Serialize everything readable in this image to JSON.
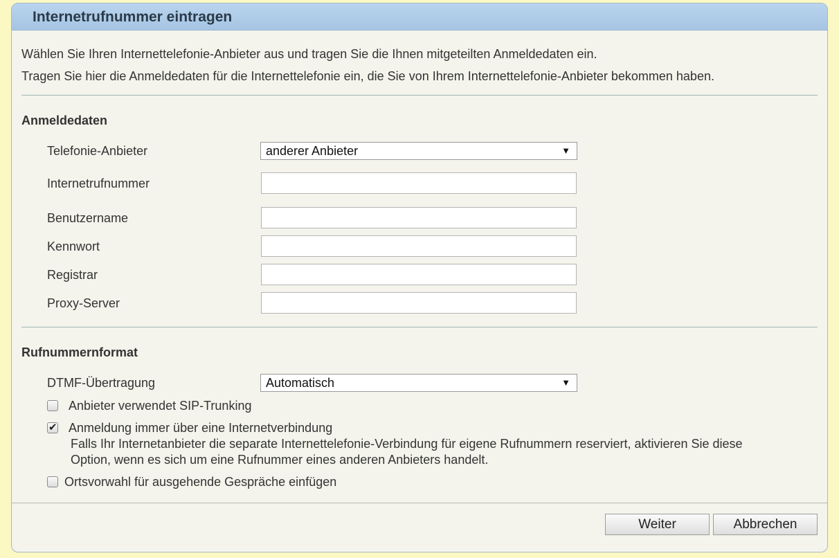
{
  "header": {
    "title": "Internetrufnummer eintragen"
  },
  "intro": {
    "line1": "Wählen Sie Ihren Internettelefonie-Anbieter aus und tragen Sie die Ihnen mitgeteilten Anmeldedaten ein.",
    "line2": "Tragen Sie hier die Anmeldedaten für die Internettelefonie ein, die Sie von Ihrem Internettelefonie-Anbieter bekommen haben."
  },
  "anmeldedaten": {
    "title": "Anmeldedaten",
    "provider_label": "Telefonie-Anbieter",
    "provider_value": "anderer Anbieter",
    "number_label": "Internetrufnummer",
    "number_value": "",
    "username_label": "Benutzername",
    "username_value": "",
    "password_label": "Kennwort",
    "password_value": "",
    "registrar_label": "Registrar",
    "registrar_value": "",
    "proxy_label": "Proxy-Server",
    "proxy_value": ""
  },
  "rufnummernformat": {
    "title": "Rufnummernformat",
    "dtmf_label": "DTMF-Übertragung",
    "dtmf_value": "Automatisch",
    "sip_trunking_label": "Anbieter verwendet SIP-Trunking",
    "sip_trunking_checked": false,
    "always_internet_label": "Anmeldung immer über eine Internetverbindung",
    "always_internet_checked": true,
    "always_internet_hint_line1": "Falls Ihr Internetanbieter die separate Internettelefonie-Verbindung für eigene Rufnummern reserviert, aktivieren Sie diese",
    "always_internet_hint_line2": "Option, wenn es sich um eine Rufnummer eines anderen Anbieters handelt.",
    "area_code_label": "Ortsvorwahl für ausgehende Gespräche einfügen",
    "area_code_checked": false
  },
  "footer": {
    "next_label": "Weiter",
    "cancel_label": "Abbrechen"
  },
  "icons": {
    "dropdown": "triangle-down-icon",
    "checkmark": "check-icon"
  },
  "colors": {
    "header": "#a6c5e3",
    "page_background": "#fbf8c4",
    "panel_background": "#f4f4ec"
  }
}
